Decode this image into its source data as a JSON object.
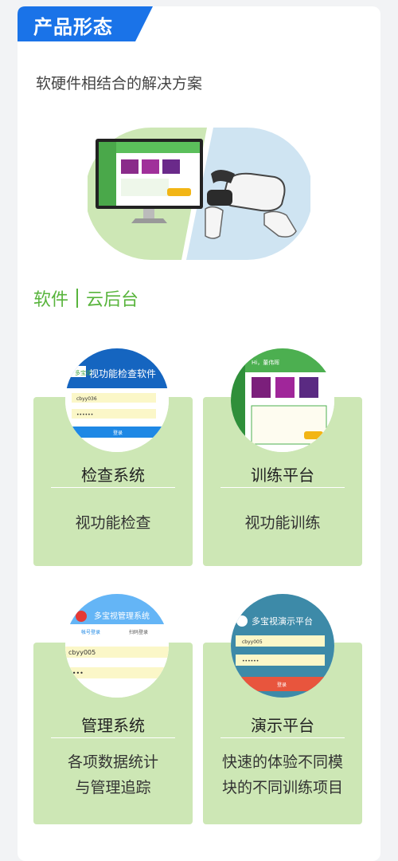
{
  "header": {
    "tag_label": "产品形态"
  },
  "intro": {
    "subtitle": "软硬件相结合的解决方案"
  },
  "software": {
    "label_left": "软件",
    "label_right": "云后台"
  },
  "products": [
    {
      "name": "检查系统",
      "desc_lines": [
        "视功能检查"
      ],
      "screen": {
        "title": "视功能检查软件",
        "brand": "多宝视",
        "username": "cbyy036",
        "password": "••••••",
        "button": "登录"
      }
    },
    {
      "name": "训练平台",
      "desc_lines": [
        "视功能训练"
      ],
      "screen": {
        "greeting": "Hi，董伟晖"
      }
    },
    {
      "name": "管理系统",
      "desc_lines": [
        "各项数据统计",
        "与管理追踪"
      ],
      "screen": {
        "title": "多宝视管理系统",
        "tab_left": "帐号登录",
        "tab_right": "扫码登录",
        "username": "cbyy005",
        "password": "••••"
      }
    },
    {
      "name": "演示平台",
      "desc_lines": [
        "快速的体验不同模",
        "块的不同训练项目"
      ],
      "screen": {
        "title": "多宝视演示平台",
        "username": "cbyy005",
        "password": "••••••",
        "button": "登录"
      }
    }
  ],
  "colors": {
    "accent_blue": "#1a73e8",
    "accent_green": "#58b43c",
    "card_green": "#cde7b5"
  }
}
